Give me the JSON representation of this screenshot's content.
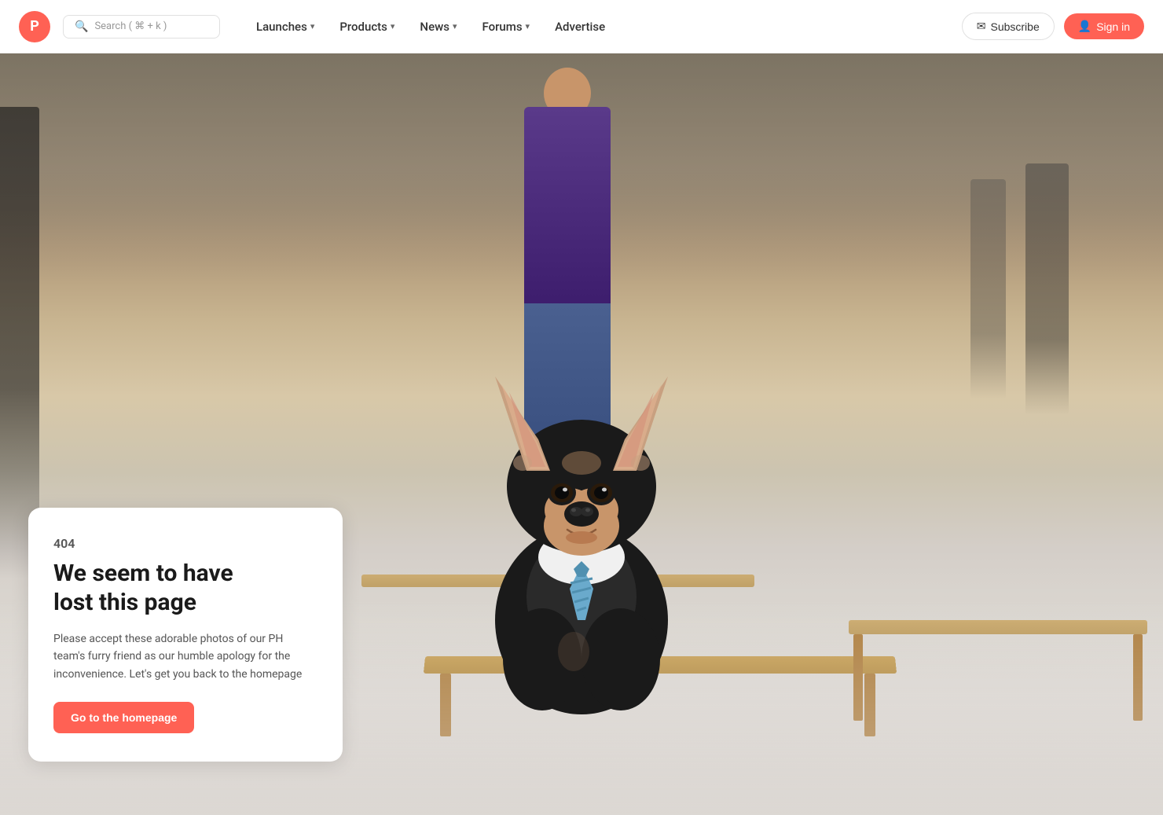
{
  "navbar": {
    "logo_letter": "P",
    "logo_color": "#ff6154",
    "search_placeholder": "Search ( ⌘ + k )",
    "nav_items": [
      {
        "id": "launches",
        "label": "Launches",
        "has_chevron": true
      },
      {
        "id": "products",
        "label": "Products",
        "has_chevron": true
      },
      {
        "id": "news",
        "label": "News",
        "has_chevron": true
      },
      {
        "id": "forums",
        "label": "Forums",
        "has_chevron": true
      },
      {
        "id": "advertise",
        "label": "Advertise",
        "has_chevron": false
      }
    ],
    "subscribe_label": "Subscribe",
    "signin_label": "Sign in"
  },
  "error_page": {
    "code": "404",
    "title_line1": "We seem to have",
    "title_line2": "lost this page",
    "description": "Please accept these adorable photos of our PH team's furry friend as our humble apology for the inconvenience. Let's get you back to the homepage",
    "cta_label": "Go to the homepage"
  }
}
